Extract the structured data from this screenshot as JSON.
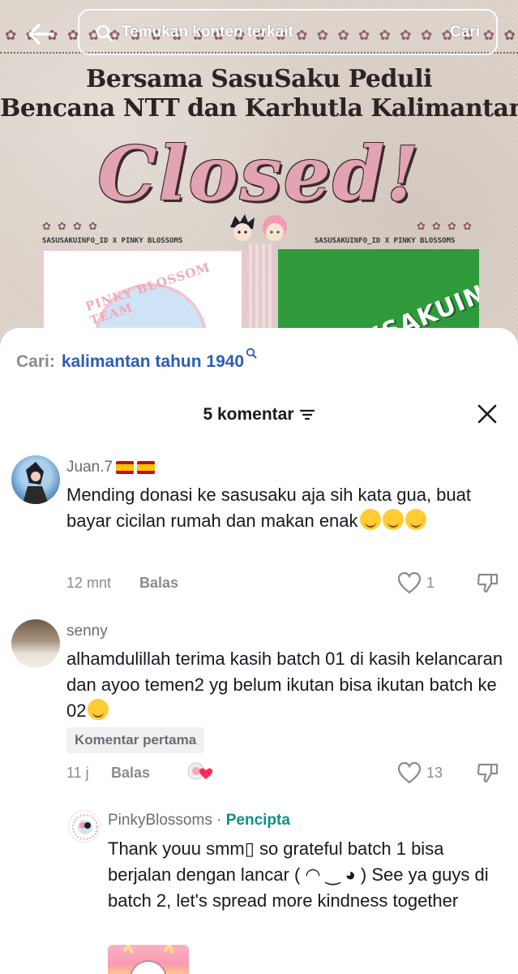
{
  "header": {
    "search_placeholder": "Temukan konten terkait",
    "search_submit": "Cari",
    "back_icon": "arrow-left-icon",
    "search_icon": "magnifier-icon"
  },
  "poster": {
    "star_row": "✿ ✿ ✿ ✿ ✿ ✿ ✿ ✿ ✿ ✿ ✿ ✿ ✿ ✿ ✿ ✿ ✿ ✿ ✿ ✿ ✿ ✿ ✿ ✿ ✿",
    "title_line1": "Bersama SasuSaku Peduli",
    "title_line2": "Bencana NTT dan Karhutla Kalimantan",
    "closed": "Closed!",
    "mini_stars": "✿ ✿ ✿ ✿",
    "credit_left": "SASUSAKUINFO_ID X PINKY BLOSSOMS",
    "credit_right": "SASUSAKUINFO_ID X PINKY BLOSSOMS",
    "left_badge": "PINKY BLOSSOM TEAM",
    "right_badge": "SASUSAKUINFO_ID"
  },
  "sheet": {
    "suggest_prefix": "Cari:",
    "suggest_query": "kalimantan tahun 1940",
    "count_label": "5 komentar",
    "close_icon": "close-icon",
    "filter_icon": "filter-icon"
  },
  "comments": [
    {
      "user": "Juan.7",
      "text": "Mending donasi ke sasusaku aja sih kata gua, buat bayar cicilan rumah dan makan enak",
      "time": "12 mnt",
      "reply_label": "Balas",
      "likes": "1"
    },
    {
      "user": "senny",
      "text": "alhamdulillah terima kasih batch 01 di kasih kelancaran dan ayoo temen2 yg belum ikutan bisa ikutan batch ke 02",
      "tag": "Komentar pertama",
      "time": "11 j",
      "reply_label": "Balas",
      "likes": "13"
    },
    {
      "user": "PinkyBlossoms",
      "separator": " · ",
      "role": "Pencipta",
      "text": "Thank youu smm▯ so grateful batch 1 bisa berjalan dengan lancar ( ◠ ‿ ◕ ) See ya guys di batch 2, let's spread more kindness together"
    }
  ],
  "colors": {
    "link": "#2b5db9",
    "muted": "#8a8b91",
    "creator": "#0a8f8f",
    "text": "#161823"
  }
}
